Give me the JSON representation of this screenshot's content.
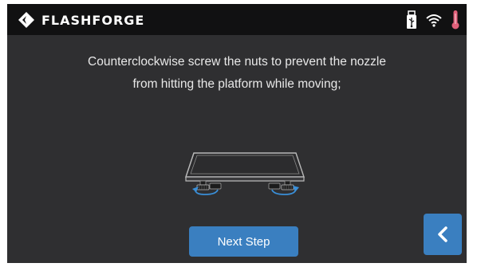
{
  "header": {
    "brand": "FLASHFORGE",
    "icons": [
      "flashforge-logo-icon",
      "usb-drive-icon",
      "wifi-icon",
      "thermometer-icon"
    ]
  },
  "instruction": {
    "line1": "Counterclockwise screw the nuts  to prevent the nozzle",
    "line2": "from hitting the platform while moving;"
  },
  "illustration": {
    "name": "build-platform-with-leveling-nuts",
    "accent_color": "#3a8fd8"
  },
  "actions": {
    "next_label": "Next Step",
    "back_icon": "chevron-left-icon"
  },
  "colors": {
    "background": "#2f2f31",
    "topbar": "#111112",
    "button": "#3a7fc0",
    "thermometer": "#e0607a"
  }
}
